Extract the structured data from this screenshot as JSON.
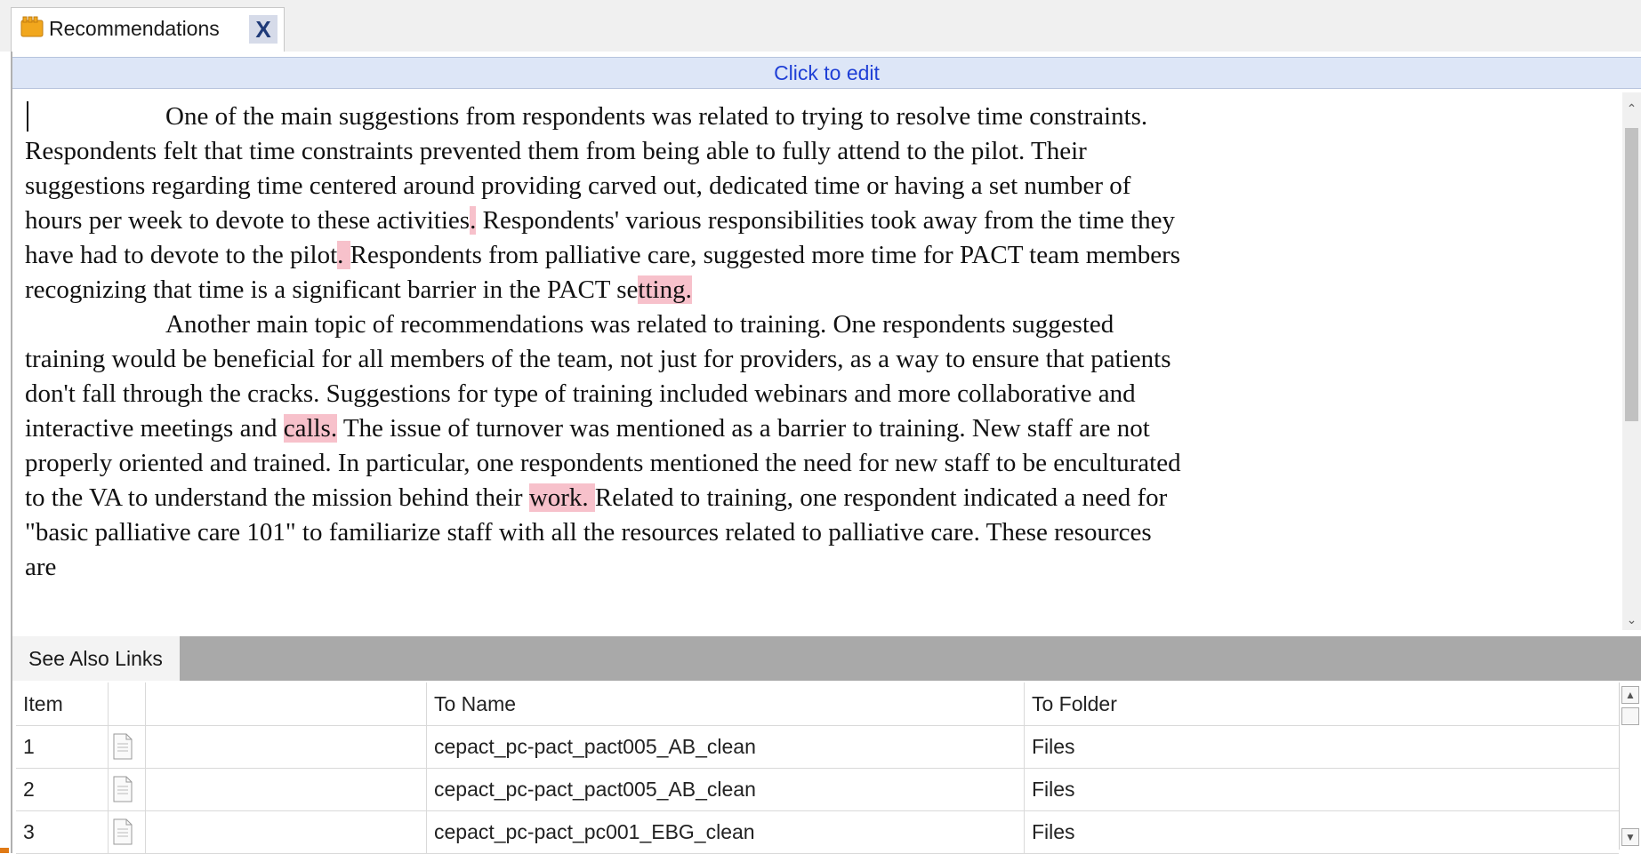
{
  "tab": {
    "label": "Recommendations",
    "close": "X"
  },
  "edit_bar": {
    "label": "Click to edit"
  },
  "document": {
    "p1": [
      {
        "t": "One of the main suggestions from respondents was related to trying to resolve time constraints. Respondents felt that time constraints prevented them from being able to fully attend to the pilot.  Their suggestions regarding time centered around providing carved out, dedicated time or having a set number of hours per week to devote to these activities",
        "h": false
      },
      {
        "t": ".",
        "h": true
      },
      {
        "t": " Respondents' various responsibilities took away from the time they have had to devote to the pilot",
        "h": false
      },
      {
        "t": ". ",
        "h": true
      },
      {
        "t": "Respondents from palliative care, suggested more time for PACT team members recognizing that time is a significant barrier in the PACT se",
        "h": false
      },
      {
        "t": "tting. ",
        "h": true
      }
    ],
    "p2": [
      {
        "t": "Another main topic of recommendations was related to training.  One respondents suggested training would be beneficial for all members of the team, not just for providers, as a way to ensure that patients don't fall through the cracks. Suggestions for type of training included webinars and more collaborative and interactive meetings and ",
        "h": false
      },
      {
        "t": "calls.",
        "h": true
      },
      {
        "t": " The issue of turnover was mentioned as a barrier to training.  New staff are not properly oriented and trained.  In particular, one respondents mentioned the need for new staff to be enculturated to the VA to understand the mission behind their ",
        "h": false
      },
      {
        "t": "work. ",
        "h": true
      },
      {
        "t": " Related to training, one respondent indicated a need for \"basic palliative care 101\" to familiarize staff with all the resources related to palliative care.  These resources are",
        "h": false
      }
    ]
  },
  "links": {
    "tab_label": "See Also Links",
    "columns": [
      "Item",
      "",
      "",
      "To Name",
      "To Folder"
    ],
    "rows": [
      {
        "item": "1",
        "name": "cepact_pc-pact_pact005_AB_clean",
        "folder": "Files"
      },
      {
        "item": "2",
        "name": "cepact_pc-pact_pact005_AB_clean",
        "folder": "Files"
      },
      {
        "item": "3",
        "name": "cepact_pc-pact_pc001_EBG_clean",
        "folder": "Files"
      }
    ]
  },
  "colors": {
    "highlight": "#f7c1cb",
    "edit_link": "#1f3fd6",
    "edit_bar_bg": "#dde6f7"
  },
  "icons": [
    "folder-icon",
    "close-icon",
    "document-icon"
  ]
}
